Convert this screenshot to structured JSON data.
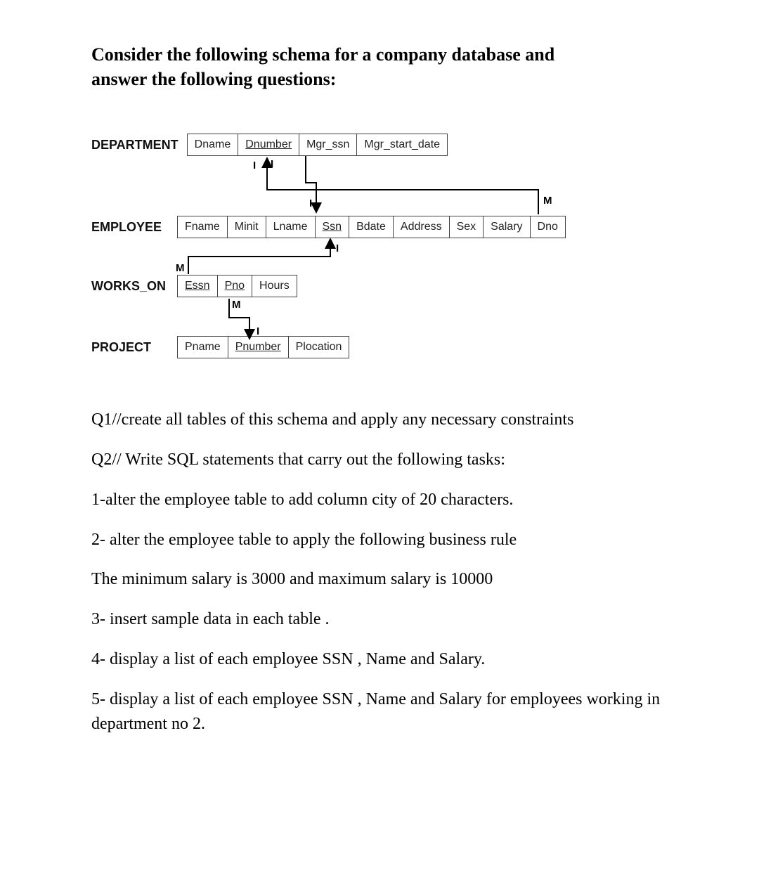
{
  "intro_line1": "Consider the following schema for a company database and",
  "intro_line2": "answer the following questions:",
  "schema": {
    "department": {
      "name": "DEPARTMENT",
      "cols": [
        "Dname",
        "Dnumber",
        "Mgr_ssn",
        "Mgr_start_date"
      ],
      "key": "Dnumber"
    },
    "employee": {
      "name": "EMPLOYEE",
      "cols": [
        "Fname",
        "Minit",
        "Lname",
        "Ssn",
        "Bdate",
        "Address",
        "Sex",
        "Salary",
        "Dno"
      ],
      "key": "Ssn"
    },
    "works_on": {
      "name": "WORKS_ON",
      "cols": [
        "Essn",
        "Pno",
        "Hours"
      ],
      "keys": [
        "Essn",
        "Pno"
      ]
    },
    "project": {
      "name": "PROJECT",
      "cols": [
        "Pname",
        "Pnumber",
        "Plocation"
      ],
      "key": "Pnumber"
    }
  },
  "cardinality": {
    "one": "I",
    "many": "M"
  },
  "questions": [
    "Q1//create all tables of this schema and apply any necessary constraints",
    "Q2// Write SQL statements that carry out the following tasks:",
    "1-alter the employee table to add column city of 20 characters.",
    "2- alter the employee table to apply the following business rule",
    "The minimum salary is 3000 and maximum salary is 10000",
    "3- insert sample data in each table .",
    "4- display a list of each employee SSN , Name and Salary.",
    "5- display a list of each employee SSN , Name and Salary for employees working in department no 2."
  ]
}
